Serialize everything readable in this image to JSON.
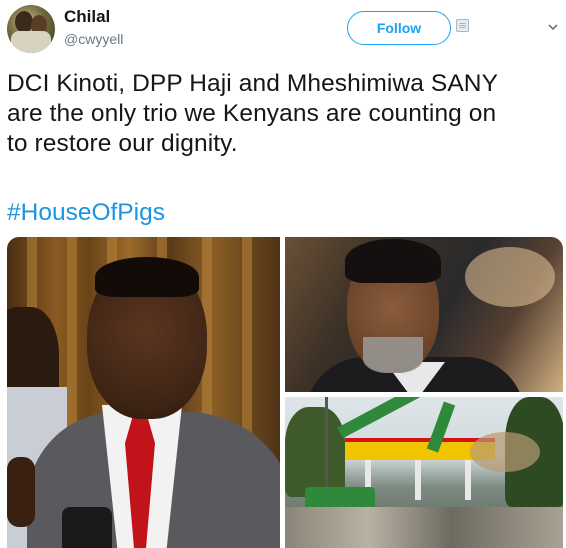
{
  "tweet": {
    "author": {
      "name": "Chilal",
      "handle": "@cwyyell"
    },
    "follow_label": "Follow",
    "text_lines": [
      "DCI Kinoti, DPP Haji and Mheshimiwa SANY",
      "are the only trio we Kenyans are counting on",
      "to restore our dignity."
    ],
    "hashtag": "#HouseOfPigs",
    "colors": {
      "accent": "#1da1f2",
      "hashtag": "#1b95e0",
      "text": "#14171a",
      "muted": "#657786"
    },
    "icons": {
      "menu": "chevron-down-icon",
      "follow_badge": "follow-badge-icon"
    }
  }
}
